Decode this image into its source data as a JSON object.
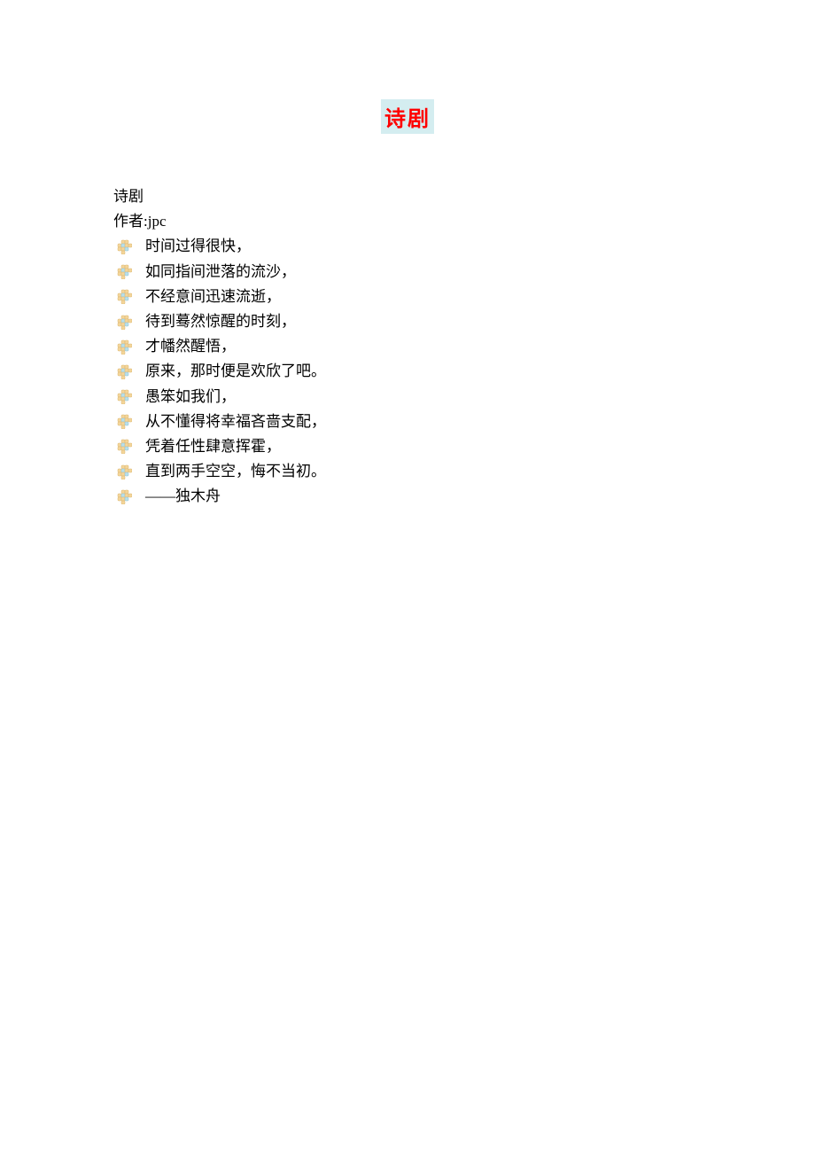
{
  "title": "诗剧",
  "subtitle": "诗剧",
  "author": "作者:jpc",
  "lines": [
    "时间过得很快，",
    "如同指间泄落的流沙，",
    "不经意间迅速流逝，",
    "待到蓦然惊醒的时刻，",
    "才幡然醒悟，",
    "原来，那时便是欢欣了吧。",
    "愚笨如我们，",
    "从不懂得将幸福吝啬支配，",
    "凭着任性肆意挥霍，",
    "直到两手空空，悔不当初。",
    "——独木舟"
  ]
}
